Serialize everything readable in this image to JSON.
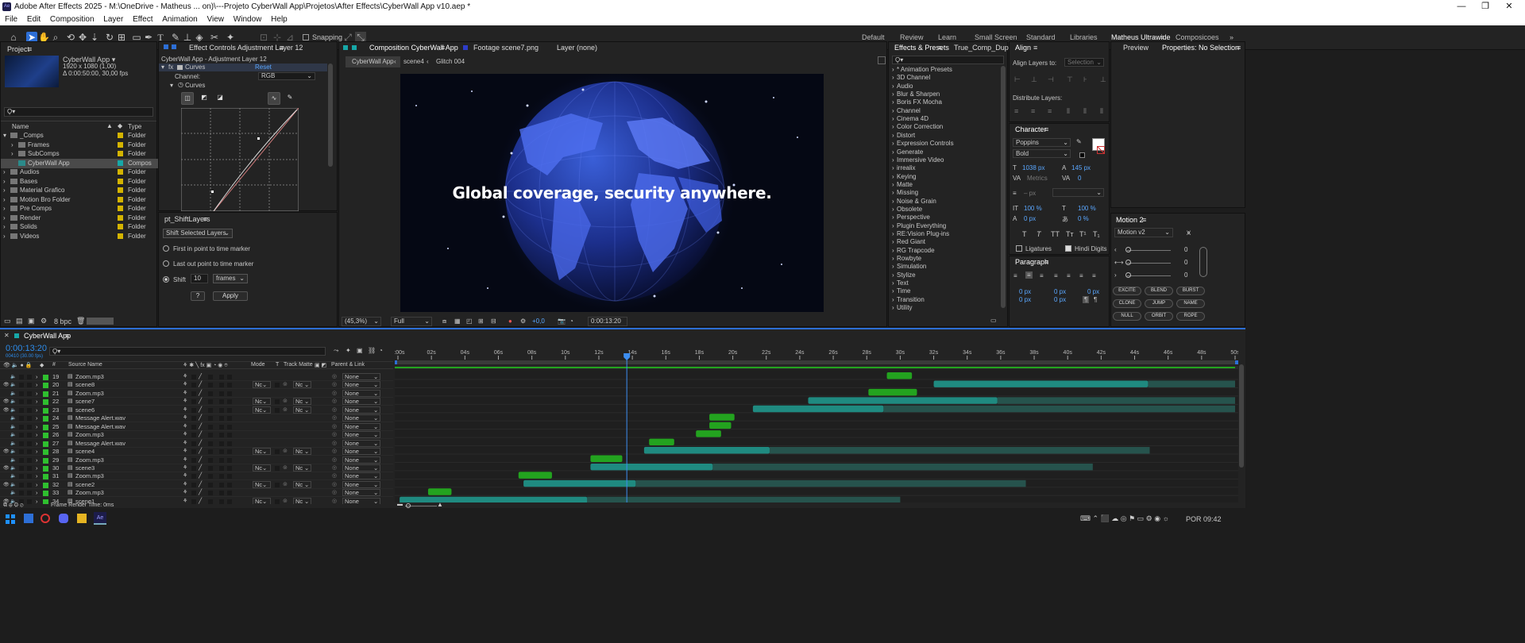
{
  "window": {
    "title": "Adobe After Effects 2025 - M:\\OneDrive - Matheus ... on)\\---Projeto CyberWall App\\Projetos\\After Effects\\CyberWall App v10.aep *",
    "controls": [
      "—",
      "❐",
      "✕"
    ]
  },
  "menu": [
    "File",
    "Edit",
    "Composition",
    "Layer",
    "Effect",
    "Animation",
    "View",
    "Window",
    "Help"
  ],
  "toolbar": {
    "snapping": "Snapping",
    "workspaces": [
      "Default",
      "Review",
      "Learn",
      "Small Screen",
      "Standard",
      "Libraries",
      "Matheus Ultrawide",
      "Composicoes"
    ],
    "active_workspace": "Matheus Ultrawide"
  },
  "project": {
    "tab": "Project",
    "comp_name": "CyberWall App ▾",
    "comp_res": "1920 x 1080 (1,00)",
    "comp_dur": "Δ 0:00:50:00, 30,00 fps",
    "search_placeholder": "Ϙ▾",
    "col_name": "Name",
    "col_type": "Type",
    "items": [
      {
        "name": "_Comps",
        "type": "Folder",
        "color": "#d4b400",
        "indent": 0,
        "open": true
      },
      {
        "name": "Frames",
        "type": "Folder",
        "color": "#d4b400",
        "indent": 1,
        "open": false
      },
      {
        "name": "SubComps",
        "type": "Folder",
        "color": "#d4b400",
        "indent": 1,
        "open": false
      },
      {
        "name": "CyberWall App",
        "type": "Compos",
        "color": "#17a8a8",
        "indent": 1,
        "selected": true
      },
      {
        "name": "Audios",
        "type": "Folder",
        "color": "#d4b400",
        "indent": 0
      },
      {
        "name": "Bases",
        "type": "Folder",
        "color": "#d4b400",
        "indent": 0
      },
      {
        "name": "Material Grafico",
        "type": "Folder",
        "color": "#d4b400",
        "indent": 0
      },
      {
        "name": "Motion Bro Folder",
        "type": "Folder",
        "color": "#d4b400",
        "indent": 0
      },
      {
        "name": "Pre Comps",
        "type": "Folder",
        "color": "#d4b400",
        "indent": 0
      },
      {
        "name": "Render",
        "type": "Folder",
        "color": "#d4b400",
        "indent": 0
      },
      {
        "name": "Solids",
        "type": "Folder",
        "color": "#d4b400",
        "indent": 0
      },
      {
        "name": "Videos",
        "type": "Folder",
        "color": "#d4b400",
        "indent": 0
      }
    ],
    "bpc": "8 bpc"
  },
  "effects": {
    "tab": "Effect Controls Adjustment Layer 12",
    "subtitle": "CyberWall App - Adjustment Layer 12",
    "fx": "fx",
    "effect": "Curves",
    "reset": "Reset",
    "channel_label": "Channel:",
    "channel_value": "RGB",
    "curves_label": "Curves"
  },
  "shift": {
    "tab": "pt_ShiftLayers",
    "mode": "Shift Selected Layers",
    "opt1": "First in point to time marker",
    "opt2": "Last out point to time marker",
    "opt3": "Shift",
    "amount": "10",
    "unit": "frames",
    "help": "?",
    "apply": "Apply"
  },
  "comp": {
    "tab": "Composition CyberWall App",
    "footage_tab": "Footage scene7.png",
    "layer_tab": "Layer (none)",
    "breadcrumbs": [
      "CyberWall App",
      "scene4",
      "Glitch 004"
    ],
    "headline": "Global coverage, security anywhere.",
    "zoom": "(45,3%)",
    "quality": "Full",
    "exposure": "+0,0",
    "timecode": "0:00:13:20"
  },
  "fxpresets": {
    "tab": "Effects & Presets",
    "tab2": "True_Comp_Dupl",
    "search": "Ϙ▾",
    "items": [
      "* Animation Presets",
      "3D Channel",
      "Audio",
      "Blur & Sharpen",
      "Boris FX Mocha",
      "Channel",
      "Cinema 4D",
      "Color Correction",
      "Distort",
      "Expression Controls",
      "Generate",
      "Immersive Video",
      "irrealix",
      "Keying",
      "Matte",
      "Missing",
      "Noise & Grain",
      "Obsolete",
      "Perspective",
      "Plugin Everything",
      "RE:Vision Plug-ins",
      "Red Giant",
      "RG Trapcode",
      "Rowbyte",
      "Simulation",
      "Stylize",
      "Text",
      "Time",
      "Transition",
      "Utility"
    ]
  },
  "align": {
    "tab": "Align",
    "align_to_label": "Align Layers to:",
    "align_to": "Selection",
    "distribute": "Distribute Layers:"
  },
  "character": {
    "tab": "Character",
    "font": "Poppins",
    "style": "Bold",
    "size": "1038 px",
    "leading": "145 px",
    "kerning": "Metrics",
    "tracking": "0",
    "stroke": "– px",
    "vscale": "100 %",
    "hscale": "100 %",
    "baseline": "0 px",
    "tsume": "0 %",
    "ligatures": "Ligatures",
    "hindi": "Hindi Digits"
  },
  "paragraph": {
    "tab": "Paragraph",
    "fields": [
      "0 px",
      "0 px",
      "0 px",
      "0 px",
      "0 px"
    ]
  },
  "preview": {
    "tab": "Preview",
    "tab2": "Properties: No Selection"
  },
  "motion": {
    "tab": "Motion 2",
    "version": "Motion v2",
    "values": [
      "0",
      "0",
      "0"
    ],
    "buttons": [
      "EXCITE",
      "BLEND",
      "BURST",
      "CLONE",
      "JUMP",
      "NAME",
      "NULL",
      "ORBIT",
      "ROPE"
    ]
  },
  "timeline": {
    "tab": "CyberWall App",
    "timecode": "0:00:13:20",
    "frames": "00410 (30.00 fps)",
    "col_source": "Source Name",
    "col_mode": "Mode",
    "col_t": "T",
    "col_matte": "Track Matte",
    "col_parent": "Parent & Link",
    "ruler": [
      "0:00s",
      "02s",
      "04s",
      "06s",
      "08s",
      "10s",
      "12s",
      "14s",
      "16s",
      "18s",
      "20s",
      "22s",
      "24s",
      "26s",
      "28s",
      "30s",
      "32s",
      "34s",
      "36s",
      "38s",
      "40s",
      "42s",
      "44s",
      "46s",
      "48s",
      "50s"
    ],
    "render_time": "Frame Render Time: 0ms",
    "layers": [
      {
        "n": "19",
        "name": "Zoom.mp3",
        "type": "audio",
        "color": "#2fbf2f",
        "mode": "",
        "matte": "",
        "start": 29.2,
        "end": 30.7,
        "bar": "audio"
      },
      {
        "n": "20",
        "name": "scene8",
        "type": "img",
        "color": "#2fbf2f",
        "mode": "Nc",
        "matte": "Nc",
        "start": 32.0,
        "end": 44.8,
        "bar": "video",
        "tail": 50
      },
      {
        "n": "21",
        "name": "Zoom.mp3",
        "type": "audio",
        "color": "#2fbf2f",
        "mode": "",
        "matte": "",
        "start": 28.1,
        "end": 31.0,
        "bar": "audio"
      },
      {
        "n": "22",
        "name": "scene7",
        "type": "img",
        "color": "#2fbf2f",
        "mode": "Nc",
        "matte": "Nc",
        "start": 24.5,
        "end": 35.8,
        "bar": "video",
        "tail": 50
      },
      {
        "n": "23",
        "name": "scene6",
        "type": "img",
        "color": "#2fbf2f",
        "mode": "Nc",
        "matte": "Nc",
        "start": 21.2,
        "end": 29.0,
        "bar": "video",
        "tail": 50
      },
      {
        "n": "24",
        "name": "Message Alert.wav",
        "type": "audio",
        "color": "#2fbf2f",
        "mode": "",
        "matte": "",
        "start": 18.6,
        "end": 20.1,
        "bar": "audio"
      },
      {
        "n": "25",
        "name": "Message Alert.wav",
        "type": "audio",
        "color": "#2fbf2f",
        "mode": "",
        "matte": "",
        "start": 18.6,
        "end": 19.9,
        "bar": "audio"
      },
      {
        "n": "26",
        "name": "Zoom.mp3",
        "type": "audio",
        "color": "#2fbf2f",
        "mode": "",
        "matte": "",
        "start": 17.8,
        "end": 19.3,
        "bar": "audio"
      },
      {
        "n": "27",
        "name": "Message Alert.wav",
        "type": "audio",
        "color": "#2fbf2f",
        "mode": "",
        "matte": "",
        "start": 15.0,
        "end": 16.5,
        "bar": "audio"
      },
      {
        "n": "28",
        "name": "scene4",
        "type": "img",
        "color": "#2fbf2f",
        "mode": "Nc",
        "matte": "Nc",
        "start": 14.7,
        "end": 22.2,
        "bar": "video",
        "tail": 44.9
      },
      {
        "n": "29",
        "name": "Zoom.mp3",
        "type": "audio",
        "color": "#2fbf2f",
        "mode": "",
        "matte": "",
        "start": 11.5,
        "end": 13.4,
        "bar": "audio"
      },
      {
        "n": "30",
        "name": "scene3",
        "type": "img",
        "color": "#2fbf2f",
        "mode": "Nc",
        "matte": "Nc",
        "start": 11.5,
        "end": 18.8,
        "bar": "video",
        "tail": 41.5
      },
      {
        "n": "31",
        "name": "Zoom.mp3",
        "type": "audio",
        "color": "#2fbf2f",
        "mode": "",
        "matte": "",
        "start": 7.2,
        "end": 9.2,
        "bar": "audio"
      },
      {
        "n": "32",
        "name": "scene2",
        "type": "img",
        "color": "#2fbf2f",
        "mode": "Nc",
        "matte": "Nc",
        "start": 7.5,
        "end": 14.2,
        "bar": "video",
        "tail": 37.5
      },
      {
        "n": "33",
        "name": "Zoom.mp3",
        "type": "audio",
        "color": "#2fbf2f",
        "mode": "",
        "matte": "",
        "start": 1.8,
        "end": 3.2,
        "bar": "audio"
      },
      {
        "n": "34",
        "name": "scene1",
        "type": "img",
        "color": "#2fbf2f",
        "mode": "Nc",
        "matte": "Nc",
        "start": 0.1,
        "end": 11.3,
        "bar": "video",
        "tail": 30.0
      }
    ],
    "parent": "None",
    "playhead": 13.67
  },
  "taskbar": {
    "lang": "POR",
    "time": "09:42"
  },
  "colors": {
    "accent": "#2d8ceb",
    "video_bar": "#1f8a80",
    "video_tail": "#26534d",
    "audio_bar": "#23a31f",
    "timecode": "#2d8ceb"
  }
}
